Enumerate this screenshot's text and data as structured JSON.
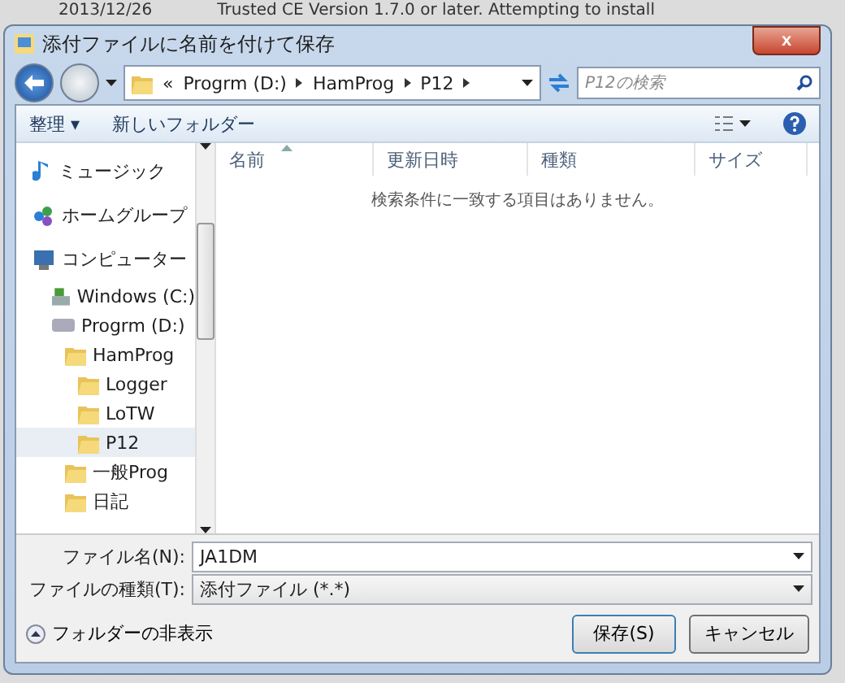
{
  "background_page": {
    "date": "2013/12/26",
    "text": "Trusted CE Version 1.7.0 or later. Attempting to install"
  },
  "window": {
    "title": "添付ファイルに名前を付けて保存",
    "close": "x"
  },
  "address_bar": {
    "overflow": "«",
    "path": [
      "Progrm (D:)",
      "HamProg",
      "P12"
    ],
    "search_placeholder": "P12の検索"
  },
  "toolbar": {
    "organize": "整理",
    "organize_caret": "▾",
    "new_folder": "新しいフォルダー"
  },
  "sidebar": {
    "items": [
      {
        "label": "ミュージック",
        "kind": "music",
        "selected": false
      },
      {
        "label": "ホームグループ",
        "kind": "homegroup",
        "selected": false
      },
      {
        "label": "コンピューター",
        "kind": "computer",
        "selected": false,
        "children": [
          {
            "label": "Windows (C:)",
            "kind": "system-drive",
            "selected": false
          },
          {
            "label": "Progrm (D:)",
            "kind": "drive",
            "selected": false,
            "children": [
              {
                "label": "HamProg",
                "kind": "folder",
                "selected": false,
                "children": [
                  {
                    "label": "Logger",
                    "kind": "folder",
                    "selected": false
                  },
                  {
                    "label": "LoTW",
                    "kind": "folder",
                    "selected": false
                  },
                  {
                    "label": "P12",
                    "kind": "folder",
                    "selected": true
                  }
                ]
              },
              {
                "label": "一般Prog",
                "kind": "folder",
                "selected": false
              },
              {
                "label": "日記",
                "kind": "folder",
                "selected": false
              }
            ]
          }
        ]
      }
    ]
  },
  "table": {
    "columns": [
      {
        "label": "名前",
        "sorted": true
      },
      {
        "label": "更新日時",
        "sorted": false
      },
      {
        "label": "種類",
        "sorted": false
      },
      {
        "label": "サイズ",
        "sorted": false
      }
    ],
    "empty_message": "検索条件に一致する項目はありません。"
  },
  "form": {
    "filename_label": "ファイル名(N):",
    "filename_value": "JA1DM",
    "filetype_label": "ファイルの種類(T):",
    "filetype_value": "添付ファイル (*.*)"
  },
  "footer": {
    "hide_folders": "フォルダーの非表示",
    "save": "保存(S)",
    "cancel": "キャンセル"
  }
}
